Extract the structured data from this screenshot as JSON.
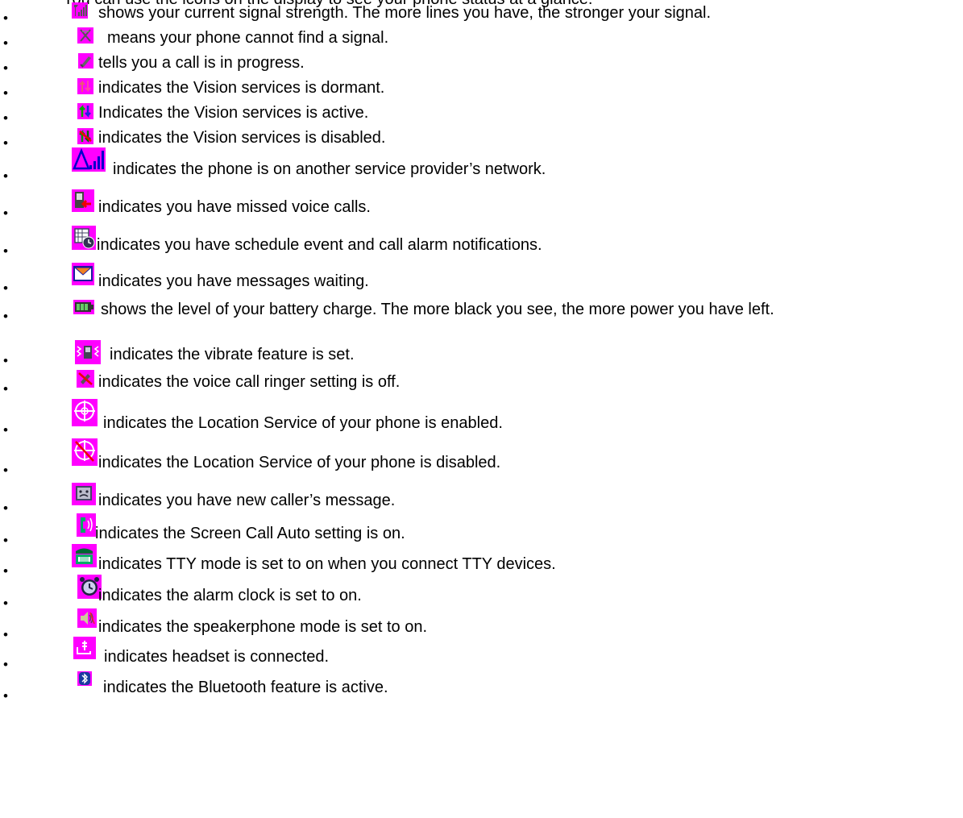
{
  "intro_fragment": "You can use the icons on the display to see your phone status at a glance.",
  "colors": {
    "icon_background": "#ff00ff",
    "text": "#000000"
  },
  "items": [
    {
      "icon": "signal-strength-icon",
      "text": "shows your current signal strength. The more lines you have, the stronger your signal."
    },
    {
      "icon": "no-signal-icon",
      "text": "means your phone cannot find a signal."
    },
    {
      "icon": "call-in-progress-icon",
      "text": "tells you a call is in progress."
    },
    {
      "icon": "vision-dormant-icon",
      "text": "indicates the Vision services is dormant."
    },
    {
      "icon": "vision-active-icon",
      "text": "Indicates the Vision services is active."
    },
    {
      "icon": "vision-disabled-icon",
      "text": "indicates the Vision services is disabled."
    },
    {
      "icon": "roaming-icon",
      "text": "indicates the phone is on another service provider’s network."
    },
    {
      "icon": "missed-call-icon",
      "text": "indicates you have missed voice calls."
    },
    {
      "icon": "schedule-alarm-icon",
      "text": "indicates you have schedule event and call alarm notifications."
    },
    {
      "icon": "message-icon",
      "text": "indicates you have messages waiting."
    },
    {
      "icon": "battery-icon",
      "text": "shows the level of your battery charge. The more black you see, the more power you have left."
    },
    {
      "icon": "vibrate-icon",
      "text": "indicates the vibrate feature is set."
    },
    {
      "icon": "ringer-off-icon",
      "text": "indicates the voice call ringer setting is off."
    },
    {
      "icon": "location-on-icon",
      "text": "indicates the Location Service of your phone is enabled."
    },
    {
      "icon": "location-off-icon",
      "text": "indicates the Location Service of your phone is disabled."
    },
    {
      "icon": "caller-message-icon",
      "text": "indicates you have new caller’s message."
    },
    {
      "icon": "screen-call-icon",
      "text": "indicates the Screen Call Auto setting is on."
    },
    {
      "icon": "tty-icon",
      "text": "indicates TTY mode is set to on when you connect TTY devices."
    },
    {
      "icon": "alarm-clock-icon",
      "text": "indicates the alarm clock is set to on."
    },
    {
      "icon": "speakerphone-icon",
      "text": "indicates the speakerphone mode is set to on."
    },
    {
      "icon": "headset-icon",
      "text": "indicates headset is connected."
    },
    {
      "icon": "bluetooth-icon",
      "text": "indicates the Bluetooth feature is active."
    }
  ]
}
